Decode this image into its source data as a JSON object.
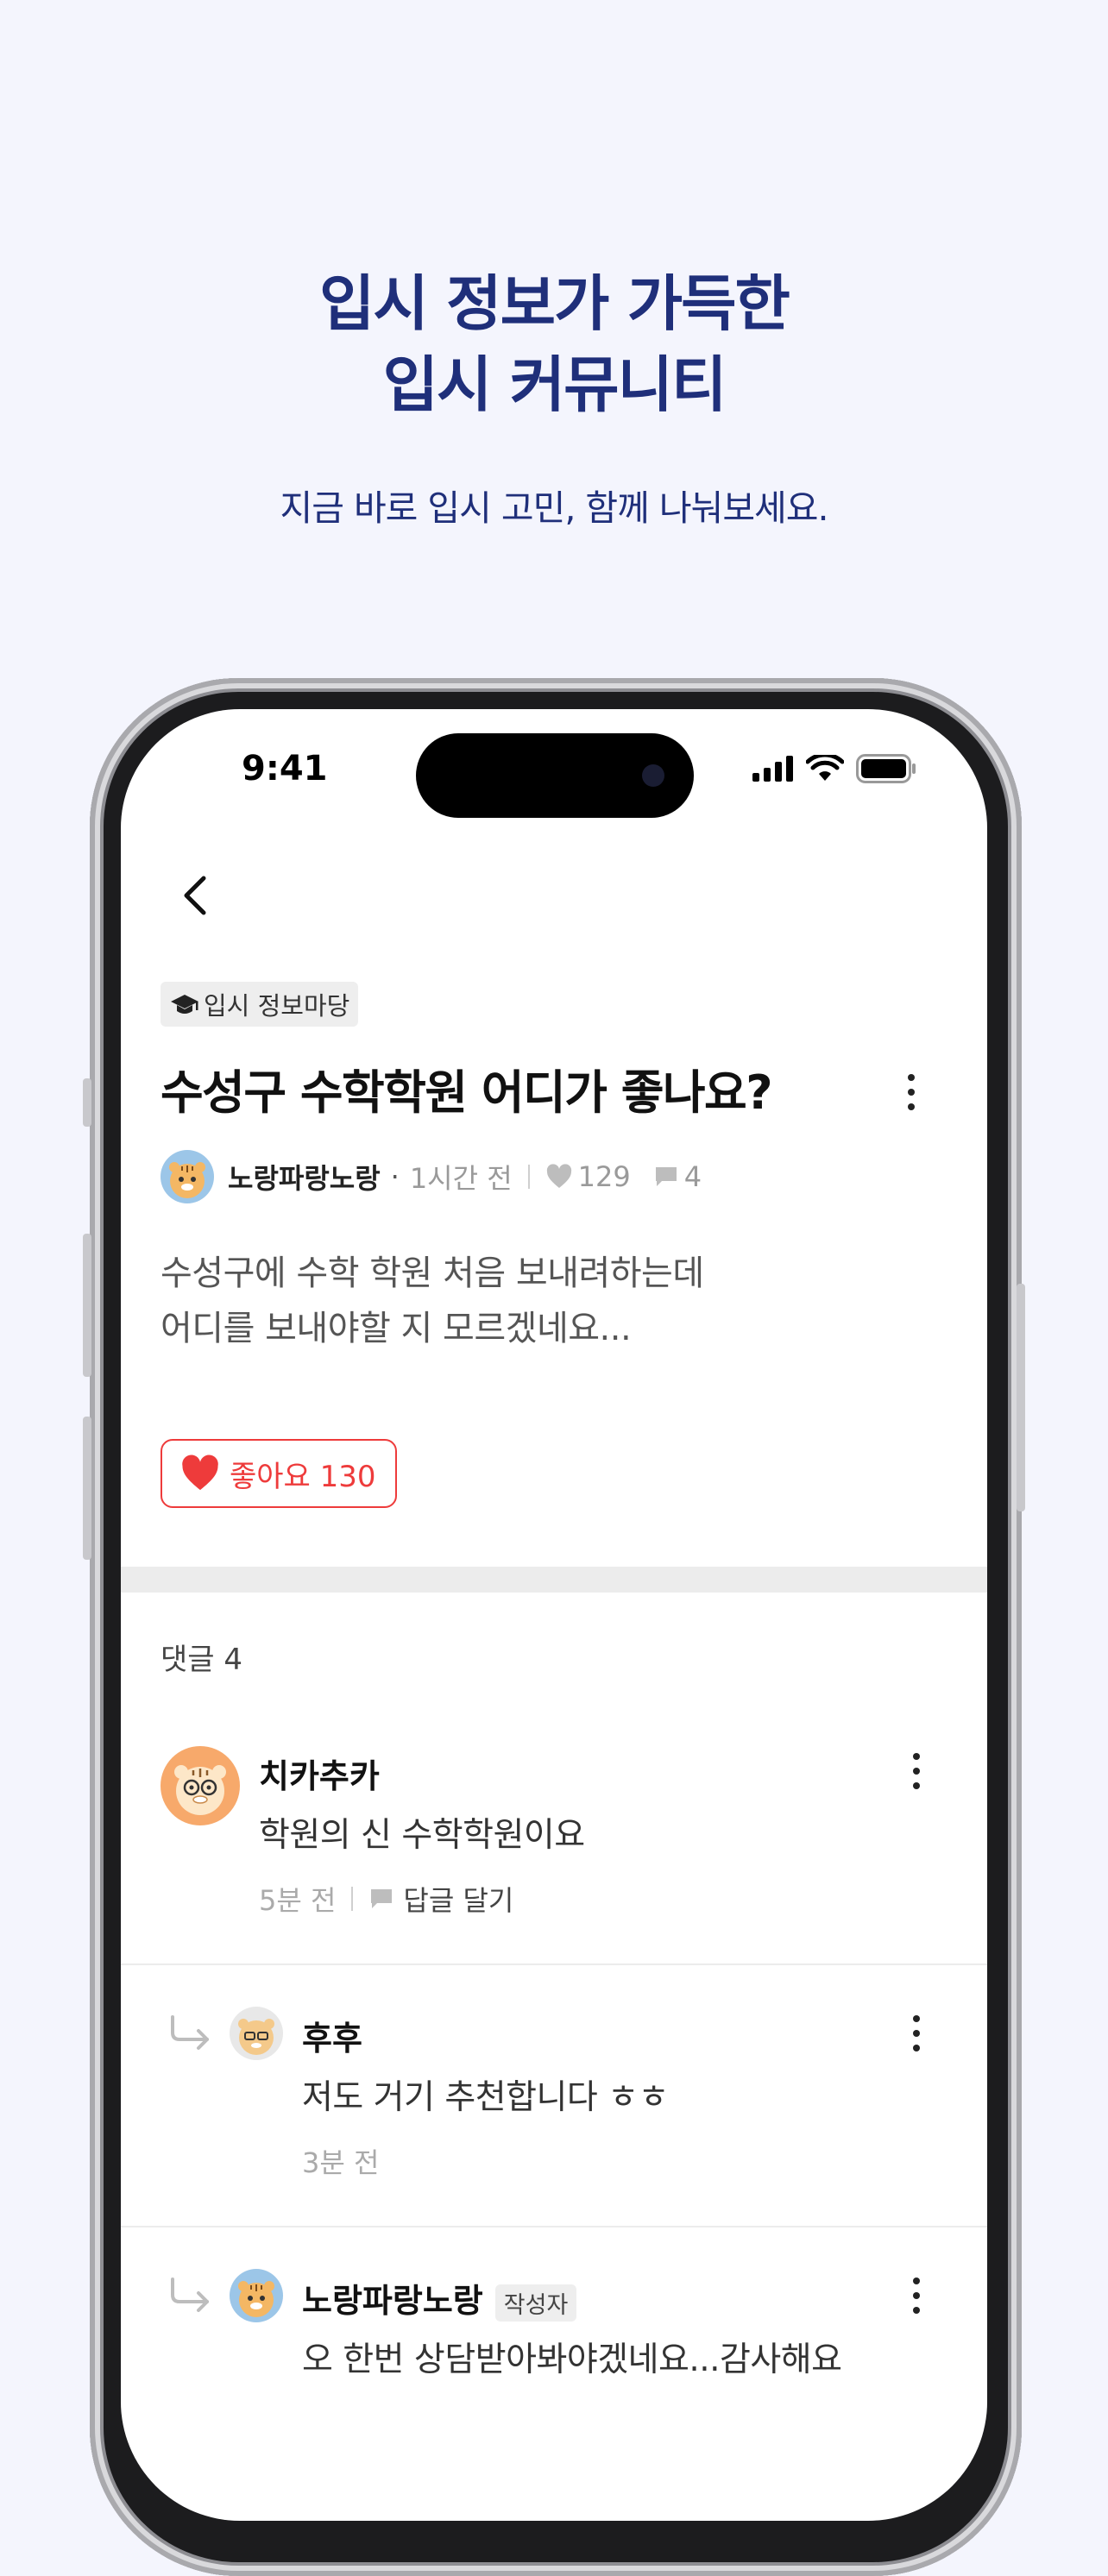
{
  "promo": {
    "title_line1": "입시 정보가 가득한",
    "title_line2": "입시 커뮤니티",
    "subtitle": "지금 바로 입시 고민, 함께 나눠보세요."
  },
  "status_bar": {
    "time": "9:41"
  },
  "post": {
    "category": "입시 정보마당",
    "title": "수성구 수학학원 어디가 좋나요?",
    "author": "노랑파랑노랑",
    "time_ago": "1시간 전",
    "like_count": "129",
    "comment_count": "4",
    "body_line1": "수성구에 수학 학원 처음 보내려하는데",
    "body_line2": "어디를 보내야할 지 모르겠네요...",
    "like_button_label": "좋아요 130"
  },
  "comments_section": {
    "header": "댓글 4",
    "comments": [
      {
        "name": "치카추카",
        "text": "학원의 신 수학학원이요",
        "time": "5분 전",
        "reply_label": "답글 달기"
      },
      {
        "name": "후후",
        "text": "저도 거기 추천합니다 ㅎㅎ",
        "time": "3분 전"
      },
      {
        "name": "노랑파랑노랑",
        "badge": "작성자",
        "text": "오 한번 상담받아봐야겠네요...감사해요"
      }
    ]
  },
  "colors": {
    "brand_navy": "#1f2f7a",
    "like_red": "#ee3b3b",
    "background": "#f4f5fd"
  }
}
